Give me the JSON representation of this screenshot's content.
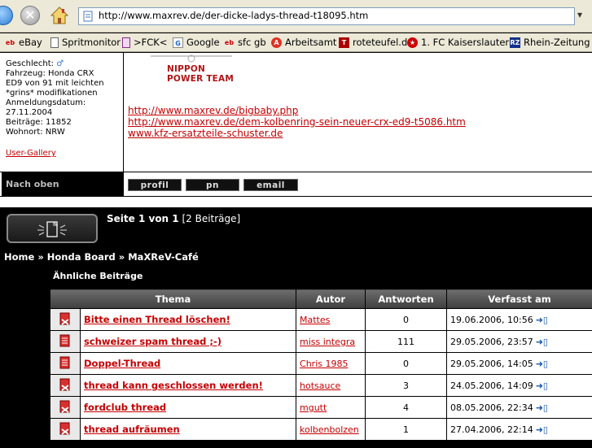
{
  "browser": {
    "url": "http://www.maxrev.de/der-dicke-ladys-thread-t18095.htm"
  },
  "bookmarks": [
    {
      "label": "eBay",
      "icon": "ebay-icon"
    },
    {
      "label": "Spritmonitor",
      "icon": "page-icon"
    },
    {
      "label": ">FCK<",
      "icon": "page-icon"
    },
    {
      "label": "Google",
      "icon": "google-icon"
    },
    {
      "label": "sfc gb",
      "icon": "ebay-icon"
    },
    {
      "label": "Arbeitsamt",
      "icon": "arbeitsamt-icon"
    },
    {
      "label": "roteteufel.d",
      "icon": "devil-icon"
    },
    {
      "label": "1. FC Kaiserslautern",
      "icon": "fck-icon"
    },
    {
      "label": "Rhein-Zeitung",
      "icon": "rz-icon"
    }
  ],
  "profile": {
    "geschlecht_label": "Geschlecht:",
    "gender_symbol": "♂",
    "fahrzeug_line1": "Fahrzeug: Honda CRX",
    "fahrzeug_line2": "ED9 von 91 mit leichten",
    "fahrzeug_line3": "*grins* modifikationen",
    "anmeldung_label": "Anmeldungsdatum:",
    "anmeldung_date": "27.11.2004",
    "beitraege": "Beiträge: 11852",
    "wohnort": "Wohnort: NRW",
    "gallery_link": "User-Gallery"
  },
  "banner_text": "NIPPON POWER TEAM",
  "signature_links": [
    "http://www.maxrev.de/bigbaby.php",
    "http://www.maxrev.de/dem-kolbenring-sein-neuer-crx-ed9-t5086.htm",
    "www.kfz-ersatzteile-schuster.de"
  ],
  "post_footer": {
    "nach_oben": "Nach oben",
    "profil": "profil",
    "pn": "pn",
    "email": "email"
  },
  "pagination": {
    "prefix": "Seite ",
    "current": "1",
    "middle": " von ",
    "total": "1",
    "suffix": " [2 Beiträge]"
  },
  "breadcrumb": [
    "Home",
    "Honda Board",
    "MaXReV-Café"
  ],
  "breadcrumb_sep": "»",
  "similar_title": "Ähnliche Beiträge",
  "topics_header": {
    "thema": "Thema",
    "autor": "Autor",
    "antworten": "Antworten",
    "verfasst": "Verfasst am"
  },
  "topics": [
    {
      "title": "Bitte einen Thread löschen!",
      "author": "Mattes",
      "replies": "0",
      "date": "19.06.2006, 10:56",
      "locked": true
    },
    {
      "title": "schweizer spam thread ;-)",
      "author": "miss integra",
      "replies": "111",
      "date": "29.05.2006, 23:57",
      "locked": false
    },
    {
      "title": "Doppel-Thread",
      "author": "Chris 1985",
      "replies": "0",
      "date": "29.05.2006, 14:05",
      "locked": false
    },
    {
      "title": "thread kann geschlossen werden!",
      "author": "hotsauce",
      "replies": "3",
      "date": "24.05.2006, 14:09",
      "locked": true
    },
    {
      "title": "fordclub thread",
      "author": "mgutt",
      "replies": "4",
      "date": "08.05.2006, 22:34",
      "locked": true
    },
    {
      "title": "thread aufräumen",
      "author": "kolbenbolzen",
      "replies": "1",
      "date": "27.04.2006, 22:14",
      "locked": true
    }
  ],
  "colors": {
    "link_red": "#c40000",
    "page_bg": "#000000",
    "header_grey": "#5a5a5a"
  }
}
